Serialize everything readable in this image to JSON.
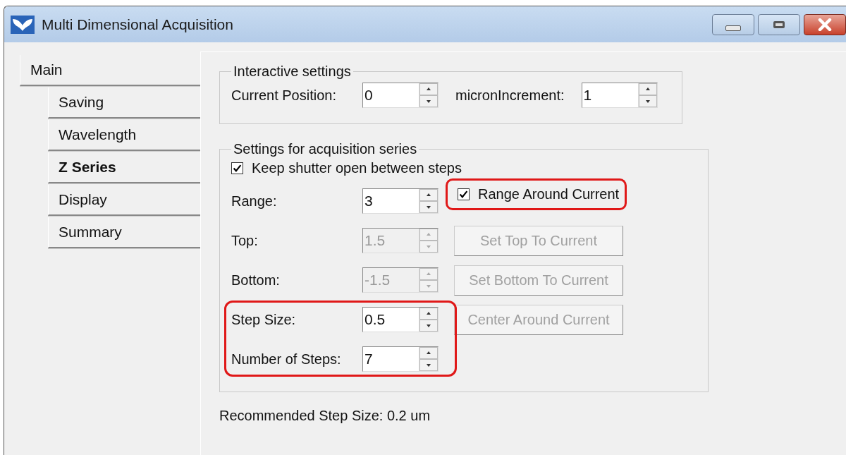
{
  "window": {
    "title": "Multi Dimensional Acquisition"
  },
  "tabs": [
    {
      "label": "Main",
      "selected": false,
      "children": [
        {
          "label": "Saving",
          "selected": false
        },
        {
          "label": "Wavelength",
          "selected": false
        },
        {
          "label": "Z Series",
          "selected": true
        },
        {
          "label": "Display",
          "selected": false
        },
        {
          "label": "Summary",
          "selected": false
        }
      ]
    }
  ],
  "interactive_settings": {
    "title": "Interactive settings",
    "fields": [
      {
        "label": "Current Position:",
        "value": "0"
      },
      {
        "label": "micronIncrement:",
        "value": "1"
      }
    ]
  },
  "acquisition_series": {
    "title": "Settings for acquisition series",
    "keep_shutter": {
      "label": "Keep shutter open between steps",
      "checked": true
    },
    "rows": [
      {
        "label": "Range:",
        "value": "3",
        "disabled": false,
        "highlighted": false,
        "side": {
          "kind": "checkbox",
          "label": "Range Around Current",
          "checked": true,
          "highlighted": true
        }
      },
      {
        "label": "Top:",
        "value": "1.5",
        "disabled": true,
        "highlighted": false,
        "side": {
          "kind": "button",
          "label": "Set Top To Current",
          "disabled": true
        }
      },
      {
        "label": "Bottom:",
        "value": "-1.5",
        "disabled": true,
        "highlighted": false,
        "side": {
          "kind": "button",
          "label": "Set Bottom To Current",
          "disabled": true
        }
      },
      {
        "label": "Step Size:",
        "value": "0.5",
        "disabled": false,
        "highlighted": true,
        "side": {
          "kind": "button",
          "label": "Center Around Current",
          "disabled": true
        }
      },
      {
        "label": "Number of Steps:",
        "value": "7",
        "disabled": false,
        "highlighted": true
      }
    ]
  },
  "recommended": "Recommended Step Size: 0.2 um"
}
